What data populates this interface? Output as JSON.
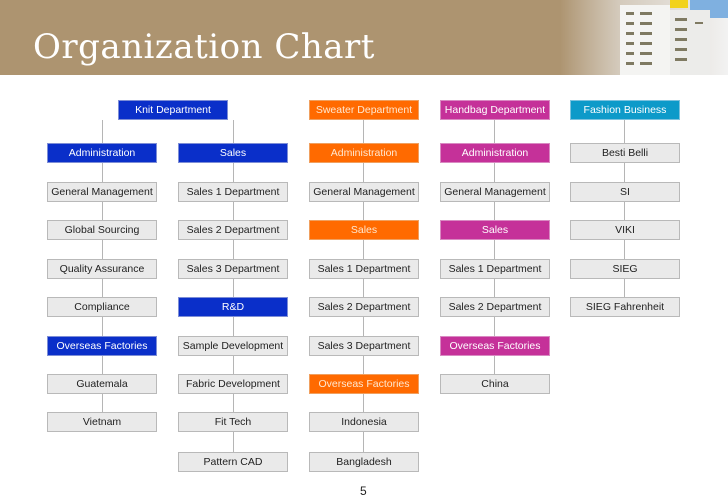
{
  "slide": {
    "title": "Organization Chart",
    "page_number": "5"
  },
  "colors": {
    "banner": "#ad9470",
    "knit": "#0a2fc9",
    "sweater": "#ff6a00",
    "handbag": "#c53199",
    "fashion": "#0d9ac9",
    "neutral": "#eaeaea"
  },
  "org": {
    "knit": {
      "label": "Knit Department",
      "administration": {
        "label": "Administration",
        "children": [
          "General Management",
          "Global Sourcing",
          "Quality Assurance",
          "Compliance"
        ],
        "overseas": {
          "label": "Overseas Factories",
          "children": [
            "Guatemala",
            "Vietnam"
          ]
        }
      },
      "sales": {
        "label": "Sales",
        "children": [
          "Sales 1 Department",
          "Sales 2 Department",
          "Sales 3 Department"
        ],
        "rnd": {
          "label": "R&D",
          "children": [
            "Sample Development",
            "Fabric Development",
            "Fit Tech",
            "Pattern CAD"
          ]
        }
      }
    },
    "sweater": {
      "label": "Sweater Department",
      "administration": "Administration",
      "general": "General Management",
      "sales": {
        "label": "Sales",
        "children": [
          "Sales 1 Department",
          "Sales 2 Department",
          "Sales 3 Department"
        ]
      },
      "overseas": {
        "label": "Overseas Factories",
        "children": [
          "Indonesia",
          "Bangladesh"
        ]
      }
    },
    "handbag": {
      "label": "Handbag Department",
      "administration": "Administration",
      "general": "General Management",
      "sales": {
        "label": "Sales",
        "children": [
          "Sales 1 Department",
          "Sales 2 Department"
        ]
      },
      "overseas": {
        "label": "Overseas Factories",
        "children": [
          "China"
        ]
      }
    },
    "fashion": {
      "label": "Fashion Business",
      "children": [
        "Besti Belli",
        "SI",
        "VIKI",
        "SIEG",
        "SIEG Fahrenheit"
      ]
    }
  }
}
